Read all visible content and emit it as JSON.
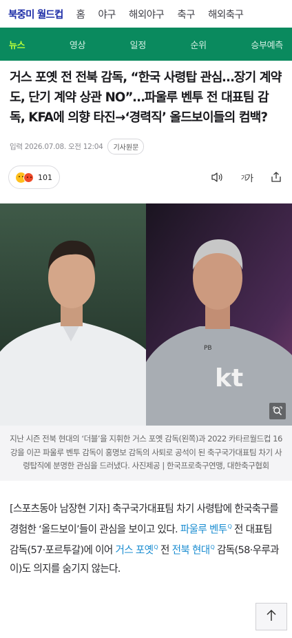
{
  "top_nav": {
    "items": [
      "북중미 월드컵",
      "홈",
      "야구",
      "해외야구",
      "축구",
      "해외축구"
    ],
    "active_index": 0,
    "active_color": "#1f2fa8"
  },
  "sub_nav": {
    "items": [
      "뉴스",
      "영상",
      "일정",
      "순위",
      "승부예측"
    ],
    "active_index": 0,
    "background": "#0a8a5e",
    "active_color": "#b9ff3a"
  },
  "article": {
    "headline": "거스 포옛 전 전북 감독, “한국 사령탑 관심…장기 계약도, 단기 계약 상관 NO”…파울루 벤투 전 대표팀 감독, KFA에 의향 타진→‘경력직’ 올드보이들의 컴백?",
    "published": "입력 2026.07.08. 오전 12:04",
    "original_button": "기사원문",
    "reaction_count": "101",
    "photo_caption": "지난 시즌 전북 현대의 ‘더블’을 지휘한 거스 포옛 감독(왼쪽)과 2022 카타르월드컵 16강을 이끈 파울루 벤투 감독이 홍명보 감독의 사퇴로 공석이 된 축구국가대표팀 차기 사령탑직에 분명한 관심을 드러냈다. 사진제공 | 한국프로축구연맹, 대한축구협회",
    "body": {
      "p1_a": "[스포츠동아 남장현 기자] 축구국가대표팀 차기 사령탑에 한국축구를 경험한 ‘올드보이’들이 관심을 보이고 있다.",
      "link1": "파울루 벤투",
      "p1_b": "전 대표팀 감독(57·포르투갈)에 이어",
      "link2": "거스 포옛",
      "p1_c": "전",
      "link3": "전북 현대",
      "p1_d": "감독(58·우루과이)도 의지를 숨기지 않는다.",
      "link_marker": "Q",
      "link_color": "#1b8dd1"
    }
  },
  "icons": [
    "laugh-emoji-icon",
    "angry-emoji-icon",
    "speaker-icon",
    "font-size-icon",
    "share-icon",
    "magnify-icon",
    "arrow-up-icon"
  ],
  "photo_badges": {
    "shirt_initials": "PB",
    "shirt_logo": "kt"
  }
}
